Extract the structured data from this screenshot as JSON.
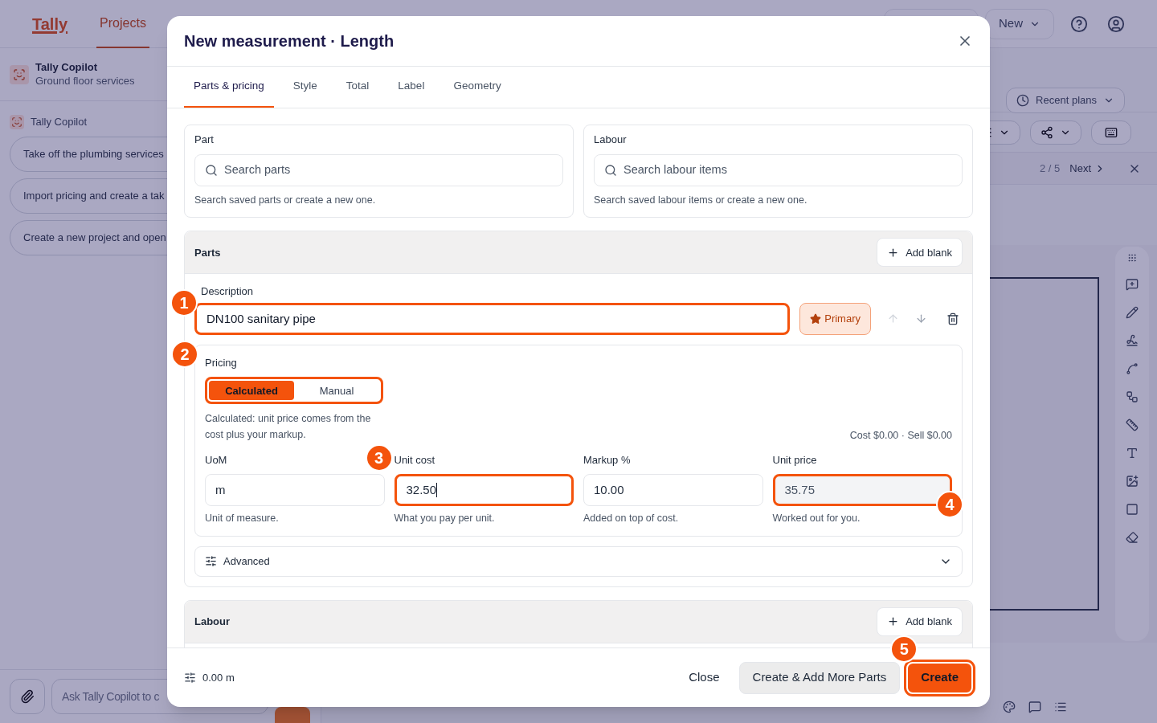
{
  "app": {
    "logo": "Tally",
    "nav": [
      {
        "label": "Projects",
        "selected": true
      }
    ],
    "new_button": "New"
  },
  "sidebar": {
    "project": {
      "title": "Tally Copilot",
      "subtitle": "Ground floor services"
    },
    "copilot_label": "Tally Copilot",
    "suggestions": [
      "Take off the plumbing services",
      "Import pricing and create a tak",
      "Create a new project and open"
    ],
    "input_placeholder": "Ask Tally Copilot to c"
  },
  "plan_toolbar": {
    "recent_plans": "Recent plans",
    "pager": "2 / 5",
    "next": "Next"
  },
  "dialog": {
    "title": "New measurement · Length",
    "tabs": [
      {
        "label": "Parts & pricing",
        "selected": true
      },
      {
        "label": "Style",
        "selected": false
      },
      {
        "label": "Total",
        "selected": false
      },
      {
        "label": "Label",
        "selected": false
      },
      {
        "label": "Geometry",
        "selected": false
      }
    ],
    "pickers": [
      {
        "label": "Part",
        "placeholder": "Search parts",
        "hint": "Search saved parts or create a new one."
      },
      {
        "label": "Labour",
        "placeholder": "Search labour items",
        "hint": "Search saved labour items or create a new one."
      }
    ],
    "parts_section": {
      "title": "Parts",
      "add": "Add blank"
    },
    "part_row": {
      "label": "Description",
      "value": "DN100 sanitary pipe",
      "callout": "1",
      "primary": "Primary",
      "primary_on": true
    },
    "pricing": {
      "label": "Pricing",
      "callout": "2",
      "modes": [
        {
          "label": "Calculated",
          "selected": true
        },
        {
          "label": "Manual",
          "selected": false
        }
      ],
      "note": "Calculated: unit price comes from the cost plus your markup.",
      "totals": "Cost $0.00 · Sell $0.00",
      "fields": [
        {
          "label": "UoM",
          "value": "m",
          "hint": "Unit of measure.",
          "kind": "input"
        },
        {
          "label": "Unit cost",
          "value": "32.50",
          "hint": "What you pay per unit.",
          "kind": "input",
          "callout": "3",
          "focused": true
        },
        {
          "label": "Markup %",
          "value": "10.00",
          "hint": "Added on top of cost.",
          "kind": "input"
        },
        {
          "label": "Unit price",
          "value": "35.75",
          "hint": "Worked out for you.",
          "kind": "readonly",
          "callout": "4"
        }
      ],
      "advanced": "Advanced"
    },
    "labour_section": {
      "title": "Labour",
      "add": "Add blank"
    },
    "footer": {
      "length": "0.00 m",
      "close": "Close",
      "create_more": "Create & Add More Parts",
      "create": "Create",
      "create_callout": "5"
    }
  }
}
